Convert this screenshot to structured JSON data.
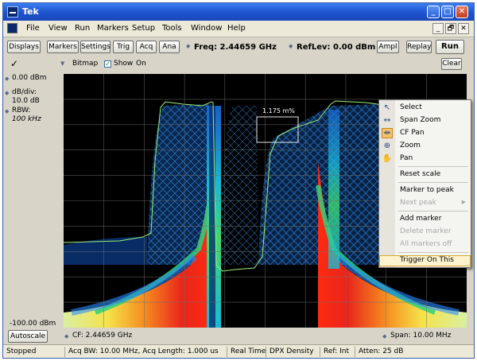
{
  "window": {
    "title": "Tek",
    "minimize": "_",
    "maximize": "□",
    "close": "✕"
  },
  "menubar": {
    "items": [
      "File",
      "View",
      "Run",
      "Markers",
      "Setup",
      "Tools",
      "Window",
      "Help"
    ],
    "doc_minimize": "_",
    "doc_restore": "🗗",
    "doc_close": "✕"
  },
  "toolbar": {
    "displays": "Displays",
    "markers": "Markers",
    "settings": "Settings",
    "trig": "Trig",
    "acq": "Acq",
    "ana": "Ana",
    "freq": "Freq: 2.44659 GHz",
    "reflev": "RefLev: 0.00 dBm",
    "ampl": "Ampl",
    "replay": "Replay",
    "run": "Run"
  },
  "subbar": {
    "checkmark": "✓",
    "bitmap": "Bitmap",
    "show": "Show",
    "on": "On",
    "clear": "Clear",
    "show_checked": true
  },
  "left_panel": {
    "ref_level": "0.00 dBm",
    "db_div_label": "dB/div:",
    "db_div_value": "10.0 dB",
    "rbw_label": "RBW:",
    "rbw_value": "100 kHz",
    "bottom_level": "-100.00 dBm"
  },
  "plot": {
    "measure_label": "1.175 m%"
  },
  "bottom_bar": {
    "autoscale": "Autoscale",
    "cf": "CF: 2.44659 GHz",
    "span": "Span: 10.00 MHz"
  },
  "status_bar": {
    "state": "Stopped",
    "acq": "Acq BW: 10.00 MHz, Acq Length: 1.000 us",
    "mode": "Real Time",
    "display": "DPX Density",
    "ref": "Ref: Int",
    "atten": "Atten: 25 dB"
  },
  "context_menu": {
    "select": "Select",
    "span_zoom": "Span Zoom",
    "cf_pan": "CF Pan",
    "zoom": "Zoom",
    "pan": "Pan",
    "reset_scale": "Reset scale",
    "marker_to_peak": "Marker to peak",
    "next_peak": "Next peak",
    "add_marker": "Add marker",
    "delete_marker": "Delete marker",
    "all_markers_off": "All markers off",
    "trigger_on_this": "Trigger On This"
  },
  "colors": {
    "trace": "#9cf07a",
    "spectrum_blue": "#2a8cff",
    "titlebar": "#1d53cf"
  }
}
